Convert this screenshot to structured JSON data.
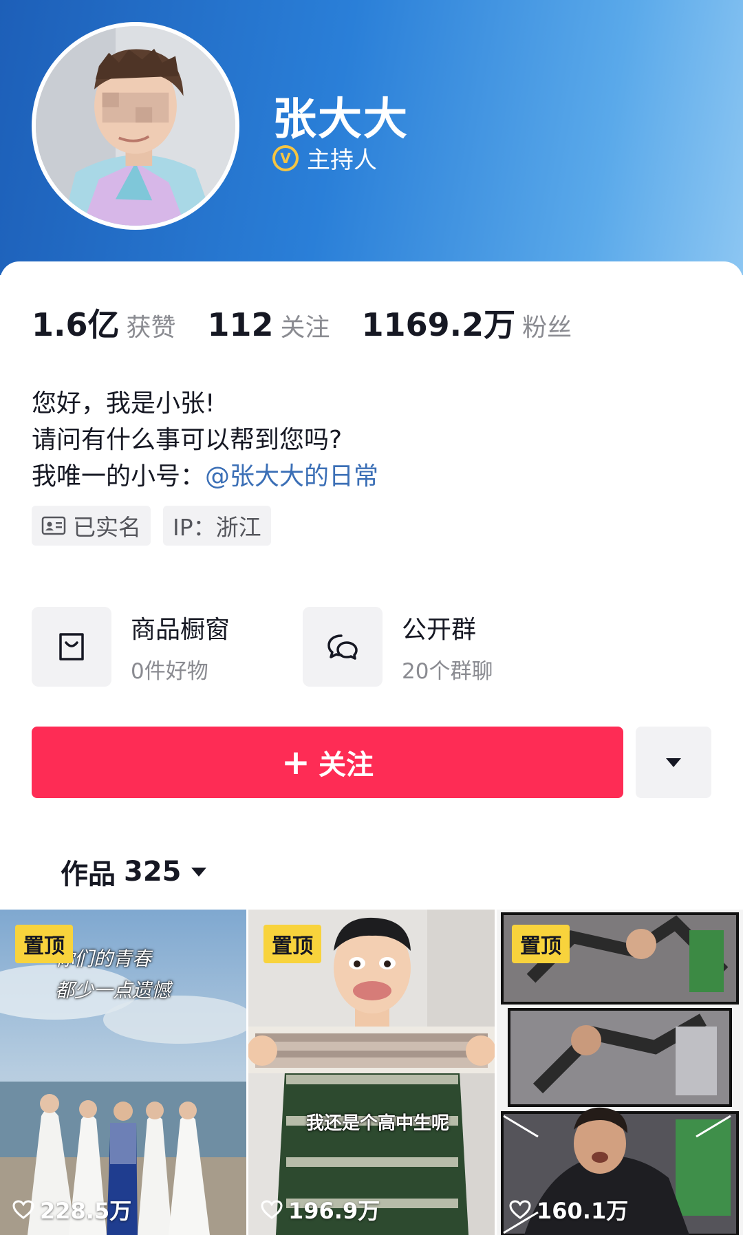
{
  "profile": {
    "name": "张大大",
    "verification": "主持人",
    "verify_badge_letter": "V"
  },
  "stats": [
    {
      "value": "1.6亿",
      "label": "获赞"
    },
    {
      "value": "112",
      "label": "关注"
    },
    {
      "value": "1169.2万",
      "label": "粉丝"
    }
  ],
  "bio": {
    "line1": "您好，我是小张!",
    "line2": "请问有什么事可以帮到您吗?",
    "line3_prefix": "我唯一的小号：",
    "line3_link": "@张大大的日常"
  },
  "tags": {
    "realname": "已实名",
    "ip": "IP：浙江"
  },
  "services": {
    "shop": {
      "title": "商品橱窗",
      "sub": "0件好物",
      "icon": "shopping-bag-icon"
    },
    "group": {
      "title": "公开群",
      "sub": "20个群聊",
      "icon": "chat-bubbles-icon"
    }
  },
  "actions": {
    "follow_plus": "+",
    "follow_label": "关注"
  },
  "works": {
    "label": "作品",
    "count": "325"
  },
  "videos": [
    {
      "pin": "置顶",
      "likes": "228.5万",
      "caption_line1": "你们的青春",
      "caption_line2": "都少一点遗憾"
    },
    {
      "pin": "置顶",
      "likes": "196.9万",
      "caption": "我还是个高中生呢"
    },
    {
      "pin": "置顶",
      "likes": "160.1万"
    }
  ],
  "colors": {
    "accent": "#fe2c55",
    "pin": "#f8d33c",
    "link": "#3b6fb6",
    "header_start": "#1d5fb8",
    "header_end": "#8cc6f2"
  }
}
